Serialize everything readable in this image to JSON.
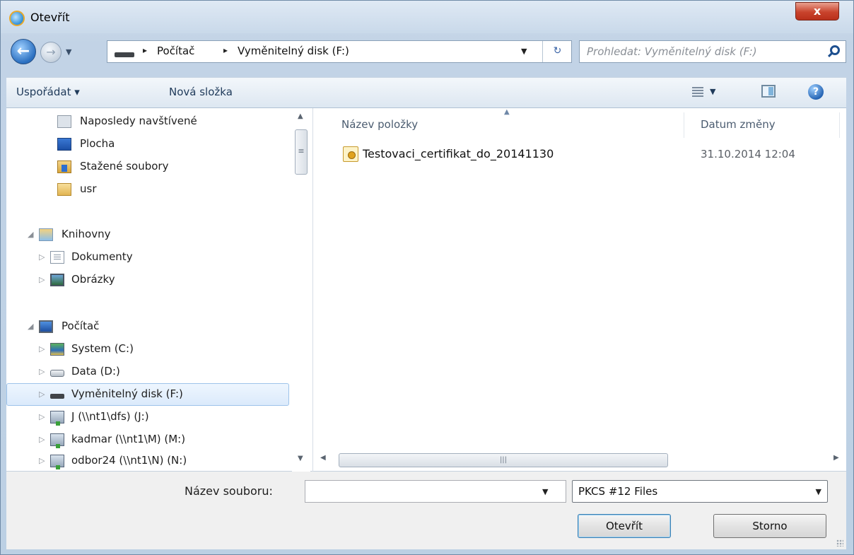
{
  "window": {
    "title": "Otevřít",
    "close_label": "x"
  },
  "navigation": {
    "breadcrumb": [
      "Počítač",
      "Vyměnitelný disk (F:)"
    ],
    "separator": "▸",
    "search_placeholder": "Prohledat: Vyměnitelný disk (F:)"
  },
  "toolbar": {
    "organize_label": "Uspořádat ▾",
    "new_folder_label": "Nová složka"
  },
  "sidebar": {
    "favorites": [
      {
        "label": "Naposledy navštívené",
        "icon": "recent-places-icon"
      },
      {
        "label": "Plocha",
        "icon": "desktop-icon"
      },
      {
        "label": "Stažené soubory",
        "icon": "downloads-icon"
      },
      {
        "label": "usr",
        "icon": "folder-icon"
      }
    ],
    "libraries": {
      "label": "Knihovny",
      "items": [
        {
          "label": "Dokumenty",
          "icon": "documents-icon"
        },
        {
          "label": "Obrázky",
          "icon": "pictures-icon"
        }
      ]
    },
    "computer": {
      "label": "Počítač",
      "items": [
        {
          "label": "System (C:)",
          "icon": "system-drive-icon"
        },
        {
          "label": "Data (D:)",
          "icon": "hard-drive-icon"
        },
        {
          "label": "Vyměnitelný disk (F:)",
          "icon": "removable-drive-icon",
          "selected": true
        },
        {
          "label": "J (\\\\nt1\\dfs) (J:)",
          "icon": "network-drive-icon"
        },
        {
          "label": "kadmar (\\\\nt1\\M) (M:)",
          "icon": "network-drive-icon"
        },
        {
          "label": "odbor24 (\\\\nt1\\N) (N:)",
          "icon": "network-drive-icon"
        }
      ]
    }
  },
  "file_list": {
    "columns": {
      "name": "Název položky",
      "date": "Datum změny"
    },
    "rows": [
      {
        "name": "Testovaci_certifikat_do_20141130",
        "date": "31.10.2014 12:04",
        "icon": "certificate-icon"
      }
    ]
  },
  "footer": {
    "filename_label": "Název souboru:",
    "filename_value": "",
    "filetype_value": "PKCS #12 Files",
    "open_label": "Otevřít",
    "cancel_label": "Storno"
  }
}
